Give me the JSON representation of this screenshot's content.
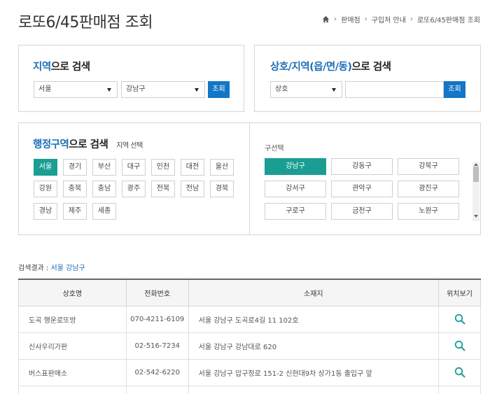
{
  "page": {
    "title": "로또6/45판매점 조회",
    "breadcrumb": [
      "판매점",
      "구입처 안내",
      "로또6/45판매점 조회"
    ]
  },
  "region_search": {
    "title_hl": "지역",
    "title_rest": "으로 검색",
    "sido_selected": "서울",
    "gugun_selected": "강남구",
    "button": "조회"
  },
  "name_search": {
    "title_hl": "상호/지역(읍/면/동)",
    "title_rest": "으로 검색",
    "type_selected": "상호",
    "query_value": "",
    "button": "조회"
  },
  "admin_search": {
    "title_hl": "행정구역",
    "title_rest": "으로 검색",
    "subtitle": "지역 선택",
    "regions": [
      "서울",
      "경기",
      "부산",
      "대구",
      "인천",
      "대전",
      "울산",
      "강원",
      "충북",
      "충남",
      "광주",
      "전북",
      "전남",
      "경북",
      "경남",
      "제주",
      "세종"
    ],
    "active_region": "서울",
    "gu_label": "구선택",
    "gus": [
      "강남구",
      "강동구",
      "강북구",
      "강서구",
      "관악구",
      "광진구",
      "구로구",
      "금천구",
      "노원구"
    ],
    "active_gu": "강남구"
  },
  "results": {
    "label": "검색결과 :",
    "value": "서울 강남구",
    "headers": [
      "상호명",
      "전화번호",
      "소재지",
      "위치보기"
    ],
    "rows": [
      {
        "name": "도곡 행운로또방",
        "phone": "070-4211-6109",
        "address": "서울 강남구 도곡로4길 11 102호"
      },
      {
        "name": "신사우리가판",
        "phone": "02-516-7234",
        "address": "서울 강남구 강남대로 620"
      },
      {
        "name": "버스표판매소",
        "phone": "02-542-6220",
        "address": "서울 강남구 압구정로 151-2 신현대9차 상가1동 출입구 앞"
      },
      {
        "name": "",
        "phone": "",
        "address": ""
      }
    ]
  },
  "colors": {
    "accent_blue": "#1376c7",
    "accent_teal": "#1a9e94",
    "title_highlight": "#1c6fb8"
  }
}
